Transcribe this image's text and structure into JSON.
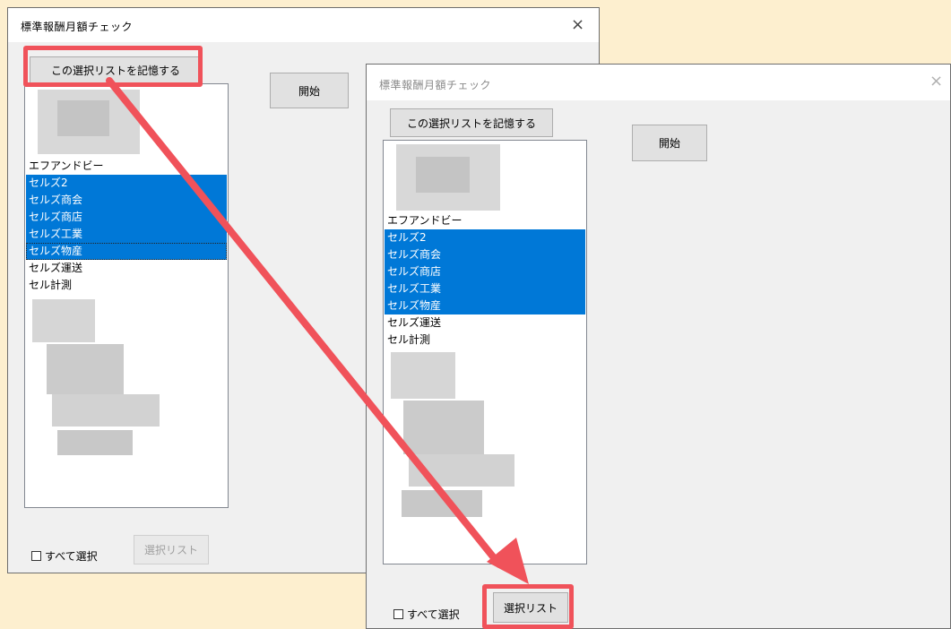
{
  "window_title": "標準報酬月額チェック",
  "close_glyph": "×",
  "remember_label": "この選択リストを記憶する",
  "start_label": "開始",
  "select_all_label": "すべて選択",
  "select_list_label": "選択リスト",
  "list_items": [
    "エフアンドビー",
    "セルズ2",
    "セルズ商会",
    "セルズ商店",
    "セルズ工業",
    "セルズ物産",
    "セルズ運送",
    "セル計測"
  ],
  "selected_items": [
    "セルズ2",
    "セルズ商会",
    "セルズ商店",
    "セルズ工業",
    "セルズ物産"
  ],
  "highlight_color": "#f0525a",
  "selection_color": "#0078d7",
  "background_color": "#fdefcf"
}
